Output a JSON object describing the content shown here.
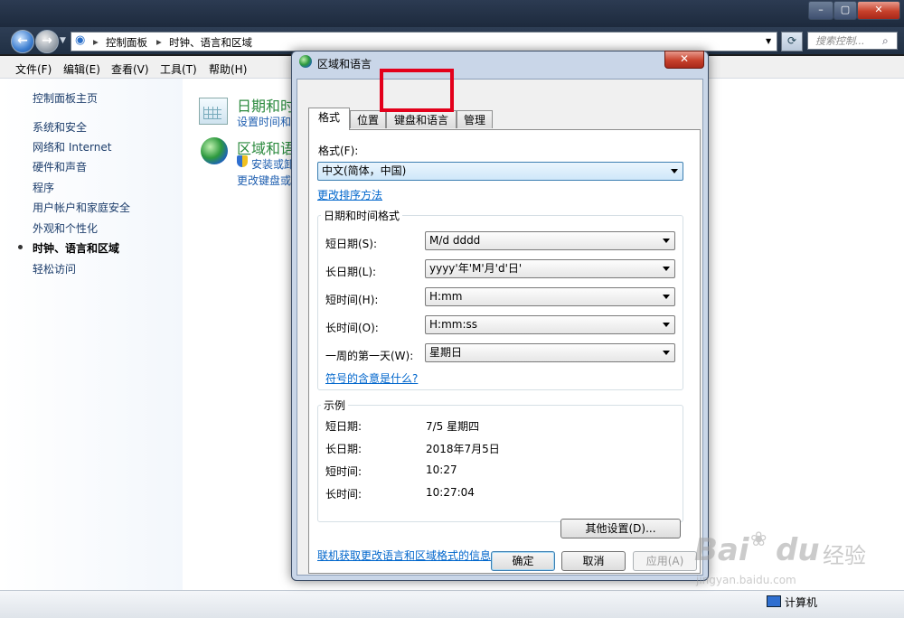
{
  "explorer": {
    "address": [
      "控制面板",
      "时钟、语言和区域"
    ],
    "search_placeholder": "搜索控制...",
    "menu": [
      "文件(F)",
      "编辑(E)",
      "查看(V)",
      "工具(T)",
      "帮助(H)"
    ],
    "sidebar": {
      "home": "控制面板主页",
      "items": [
        "系统和安全",
        "网络和 Internet",
        "硬件和声音",
        "程序",
        "用户帐户和家庭安全",
        "外观和个性化",
        "时钟、语言和区域",
        "轻松访问"
      ],
      "active_index": 6
    },
    "categories": [
      {
        "title": "日期和时",
        "links": [
          "设置时间和"
        ]
      },
      {
        "title": "区域和语",
        "links": [
          "安装或卸",
          "更改键盘或"
        ]
      }
    ],
    "status_text": "计算机"
  },
  "dialog": {
    "title": "区域和语言",
    "close_label": "✕",
    "tabs": [
      "格式",
      "位置",
      "键盘和语言",
      "管理"
    ],
    "active_tab": 0,
    "format_label": "格式(F):",
    "format_value": "中文(简体，中国)",
    "sort_link": "更改排序方法",
    "datetime_group": "日期和时间格式",
    "fields": [
      {
        "label": "短日期(S):",
        "value": "M/d dddd"
      },
      {
        "label": "长日期(L):",
        "value": "yyyy'年'M'月'd'日'"
      },
      {
        "label": "短时间(H):",
        "value": "H:mm"
      },
      {
        "label": "长时间(O):",
        "value": "H:mm:ss"
      },
      {
        "label": "一周的第一天(W):",
        "value": "星期日"
      }
    ],
    "symbols_link": "符号的含意是什么?",
    "example_group": "示例",
    "examples": [
      {
        "label": "短日期:",
        "value": "7/5 星期四"
      },
      {
        "label": "长日期:",
        "value": "2018年7月5日"
      },
      {
        "label": "短时间:",
        "value": "10:27"
      },
      {
        "label": "长时间:",
        "value": "10:27:04"
      }
    ],
    "other_settings": "其他设置(D)...",
    "online_link": "联机获取更改语言和区域格式的信息",
    "ok": "确定",
    "cancel": "取消",
    "apply": "应用(A)"
  },
  "watermark": {
    "brand": "Bai",
    "brand2": "du",
    "cn": "经验",
    "url": "jingyan.baidu.com"
  },
  "colors": {
    "highlight": "#e3001b",
    "link": "#0066cc",
    "category_title": "#2b8a3e"
  }
}
